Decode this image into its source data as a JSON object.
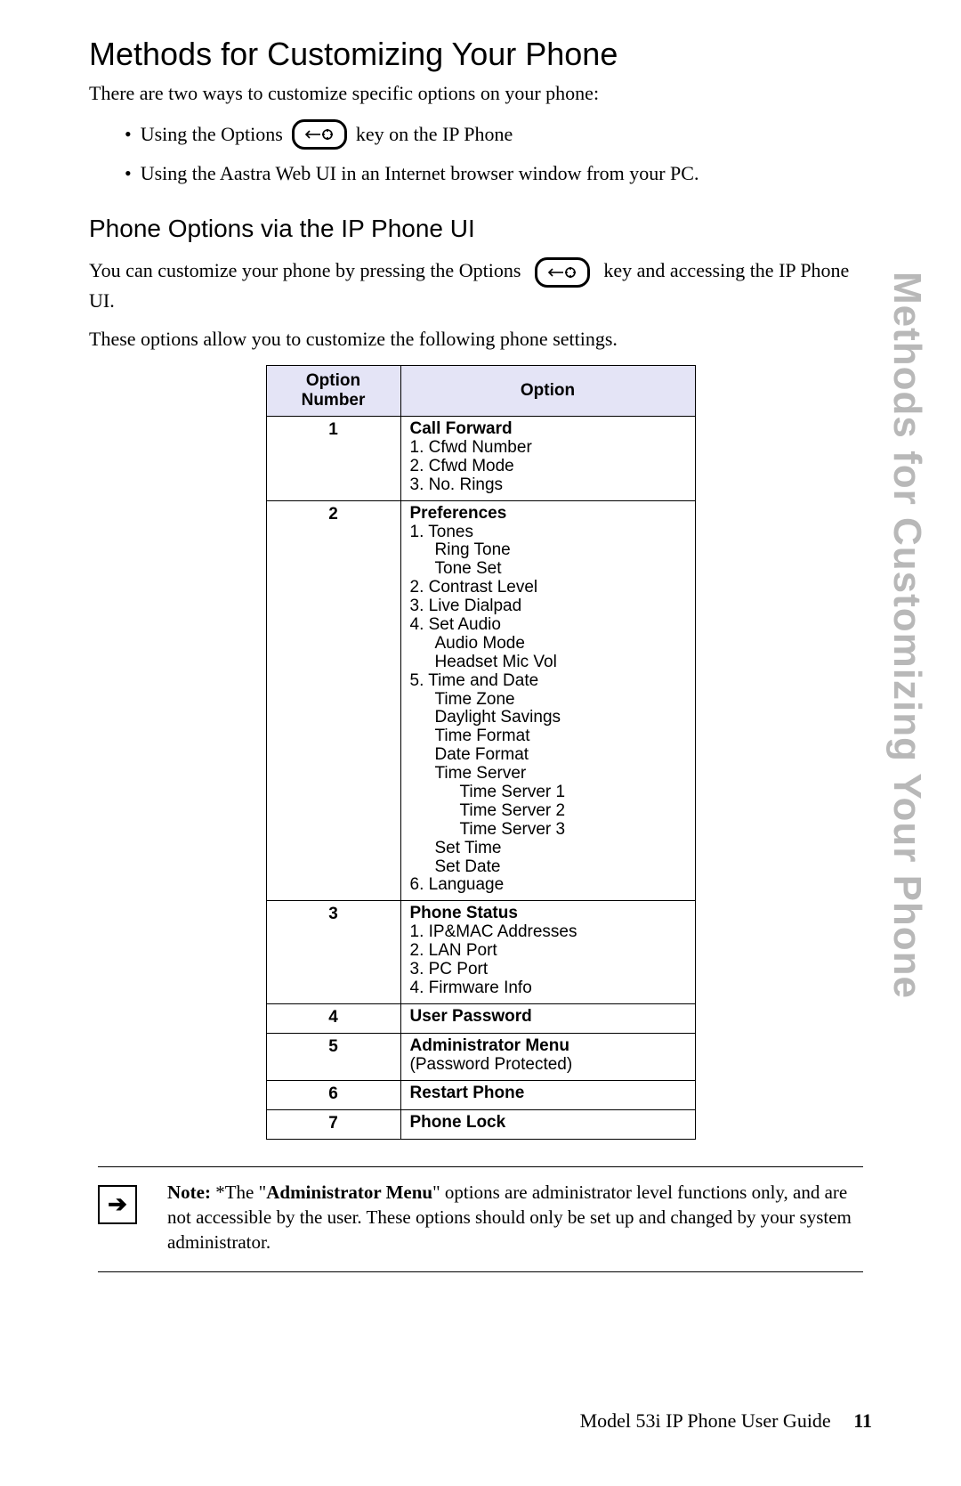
{
  "heading": "Methods for Customizing Your Phone",
  "intro": "There are two ways to customize specific options on your phone:",
  "bullet1a": "Using the Options",
  "bullet1b": "key on the IP Phone",
  "bullet2": "Using the Aastra Web UI in an Internet browser window from your PC.",
  "subheading": "Phone Options via the IP Phone UI",
  "para1a": "You can customize your phone by pressing the Options",
  "para1b": "key and accessing the IP Phone UI.",
  "para2": "These options allow you to customize the following phone settings.",
  "side_title": "Methods for Customizing Your Phone",
  "table": {
    "head_num": "Option Number",
    "head_opt": "Option",
    "rows": [
      {
        "num": "1",
        "title": "Call Forward",
        "lines": [
          {
            "t": "1. Cfwd Number",
            "l": 1
          },
          {
            "t": "2. Cfwd Mode",
            "l": 1
          },
          {
            "t": "3. No. Rings",
            "l": 1
          }
        ]
      },
      {
        "num": "2",
        "title": "Preferences",
        "lines": [
          {
            "t": "1. Tones",
            "l": 1
          },
          {
            "t": "Ring Tone",
            "l": 2
          },
          {
            "t": "Tone Set",
            "l": 2
          },
          {
            "t": "2. Contrast Level",
            "l": 1
          },
          {
            "t": "3. Live Dialpad",
            "l": 1
          },
          {
            "t": "4. Set Audio",
            "l": 1
          },
          {
            "t": "Audio Mode",
            "l": 2
          },
          {
            "t": "Headset Mic Vol",
            "l": 2
          },
          {
            "t": "5. Time and Date",
            "l": 1
          },
          {
            "t": "Time Zone",
            "l": 2
          },
          {
            "t": "Daylight Savings",
            "l": 2
          },
          {
            "t": "Time Format",
            "l": 2
          },
          {
            "t": "Date Format",
            "l": 2
          },
          {
            "t": "Time Server",
            "l": 2
          },
          {
            "t": "Time Server 1",
            "l": 3
          },
          {
            "t": "Time Server 2",
            "l": 3
          },
          {
            "t": "Time Server 3",
            "l": 3
          },
          {
            "t": "Set Time",
            "l": 2
          },
          {
            "t": "Set Date",
            "l": 2
          },
          {
            "t": "6. Language",
            "l": 1
          }
        ]
      },
      {
        "num": "3",
        "title": "Phone Status",
        "lines": [
          {
            "t": "1. IP&MAC Addresses",
            "l": 1
          },
          {
            "t": "2. LAN Port",
            "l": 1
          },
          {
            "t": "3. PC Port",
            "l": 1
          },
          {
            "t": "4. Firmware Info",
            "l": 1
          }
        ]
      },
      {
        "num": "4",
        "title": "User Password",
        "lines": []
      },
      {
        "num": "5",
        "title": "Administrator Menu",
        "lines": [
          {
            "t": "(Password Protected)",
            "l": 1
          }
        ]
      },
      {
        "num": "6",
        "title": "Restart Phone",
        "lines": []
      },
      {
        "num": "7",
        "title": "Phone Lock",
        "lines": []
      }
    ]
  },
  "note": {
    "lead": "Note: ",
    "pre": "*The \"",
    "admin": "Administrator Menu",
    "post": "\" options are administrator level functions only, and are not accessible by the user. These options should only be set up and changed by your system administrator."
  },
  "footer": {
    "title": "Model 53i IP Phone User Guide",
    "page": "11"
  }
}
